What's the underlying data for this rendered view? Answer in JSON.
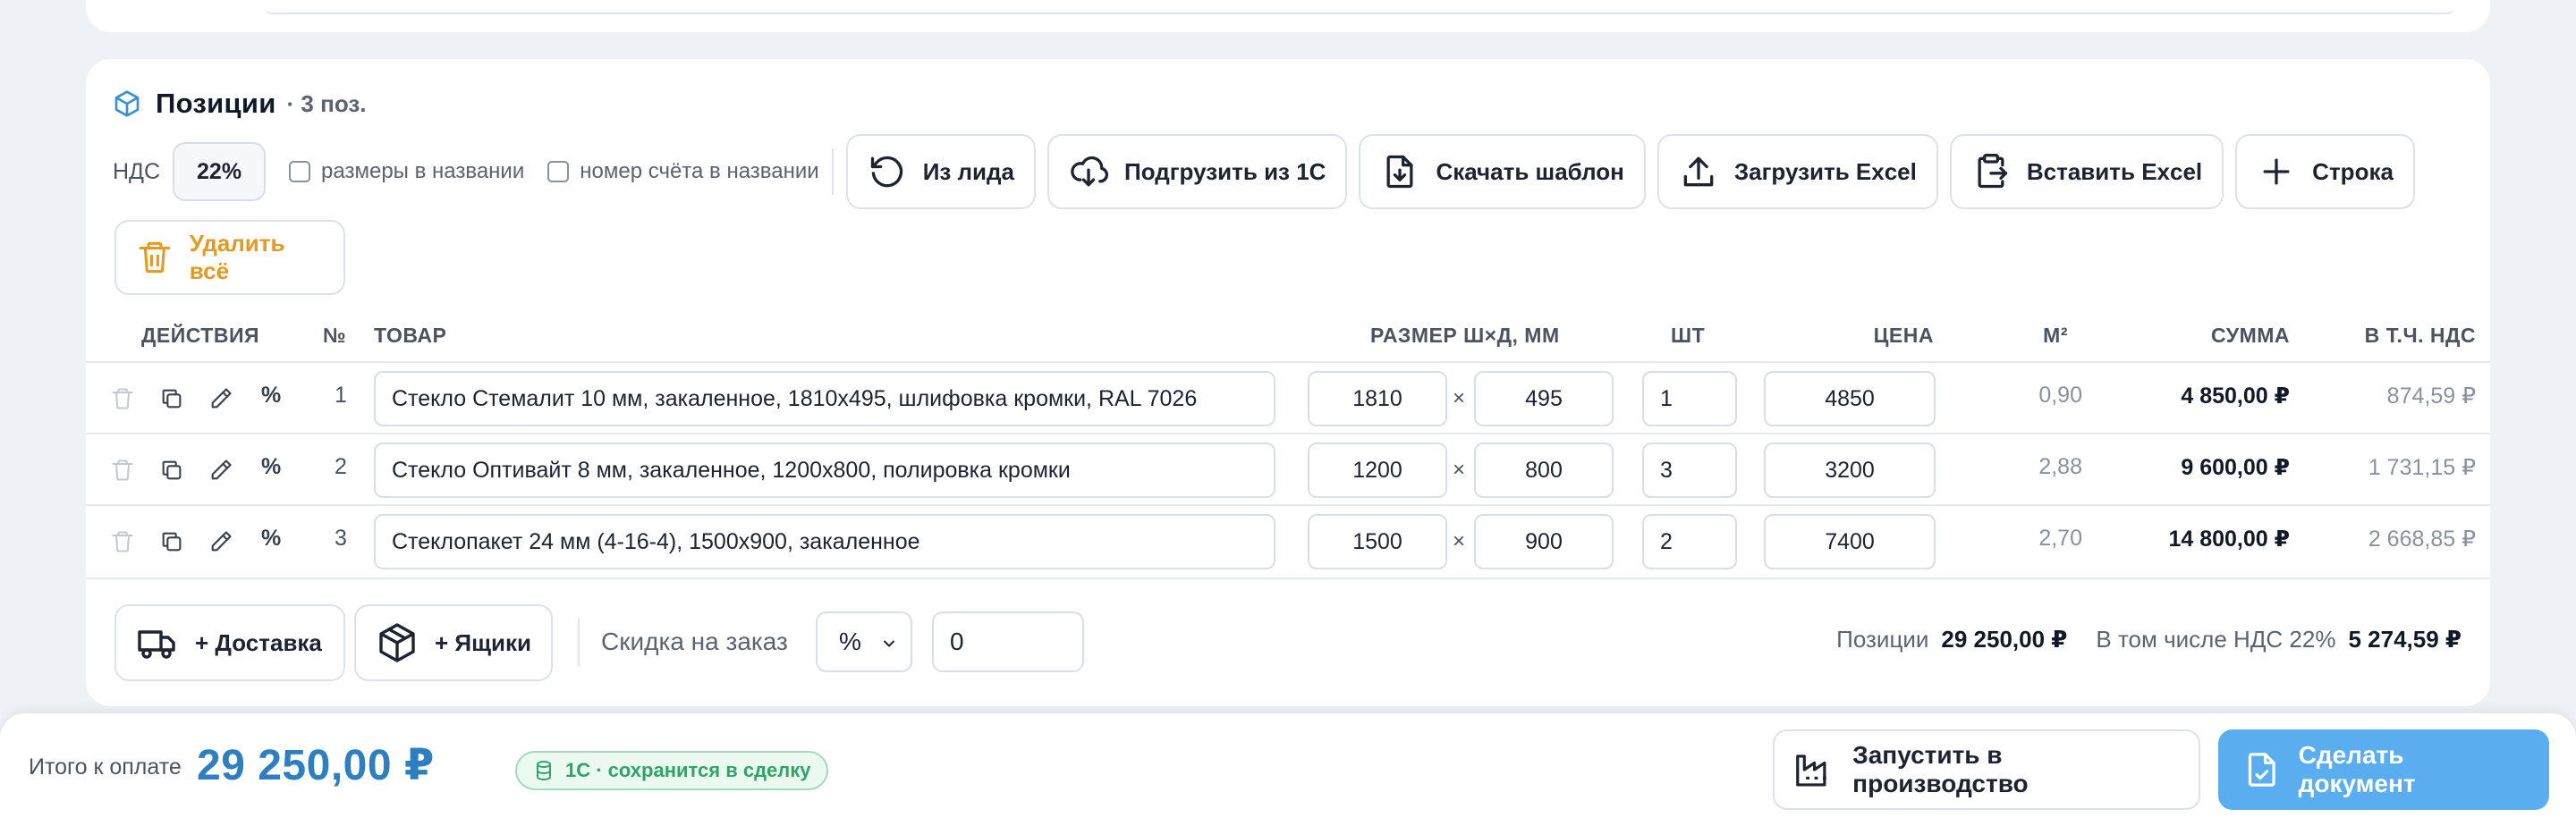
{
  "positions": {
    "title": "Позиции",
    "count": "· 3 поз."
  },
  "toolbar": {
    "vat_label": "НДС",
    "vat_value": "22%",
    "check_sizes": "размеры в названии",
    "check_invoice": "номер счёта в названии",
    "from_lead": "Из лида",
    "load_1c": "Подгрузить из 1С",
    "download_template": "Скачать шаблон",
    "upload_excel": "Загрузить Excel",
    "paste_excel": "Вставить Excel",
    "add_row": "Строка",
    "delete_all": "Удалить всё"
  },
  "table": {
    "headers": {
      "actions": "ДЕЙСТВИЯ",
      "num": "№",
      "product": "ТОВАР",
      "size": "РАЗМЕР Ш×Д, ММ",
      "qty": "ШТ",
      "price": "ЦЕНА",
      "area": "М²",
      "sum": "СУММА",
      "vat": "В Т.Ч. НДС"
    },
    "rows": [
      {
        "num": "1",
        "product": "Стекло Стемалит 10 мм, закаленное, 1810x495, шлифовка кромки, RAL 7026",
        "width": "1810",
        "length": "495",
        "qty": "1",
        "price": "4850",
        "area": "0,90",
        "sum": "4 850,00 ₽",
        "vat": "874,59 ₽"
      },
      {
        "num": "2",
        "product": "Стекло Оптивайт 8 мм, закаленное, 1200x800, полировка кромки",
        "width": "1200",
        "length": "800",
        "qty": "3",
        "price": "3200",
        "area": "2,88",
        "sum": "9 600,00 ₽",
        "vat": "1 731,15 ₽"
      },
      {
        "num": "3",
        "product": "Стеклопакет 24 мм (4-16-4), 1500x900, закаленное",
        "width": "1500",
        "length": "900",
        "qty": "2",
        "price": "7400",
        "area": "2,70",
        "sum": "14 800,00 ₽",
        "vat": "2 668,85 ₽"
      }
    ],
    "times": "×",
    "percent": "%"
  },
  "bottom": {
    "delivery": "+ Доставка",
    "boxes": "+ Ящики",
    "discount_label": "Скидка на заказ",
    "discount_type": "%",
    "discount_value": "0",
    "positions_label": "Позиции",
    "positions_total": "29 250,00 ₽",
    "vat_label": "В том числе НДС 22%",
    "vat_total": "5 274,59 ₽"
  },
  "footer": {
    "label": "Итого к оплате",
    "total": "29 250,00 ₽",
    "badge": "1С · сохранится в сделку",
    "launch": "Запустить в производство",
    "make_doc": "Сделать документ"
  },
  "colors": {
    "accent": "#2d7fc1",
    "primary_button": "#5aaef0",
    "danger": "#e39a20",
    "success": "#2ea567"
  }
}
